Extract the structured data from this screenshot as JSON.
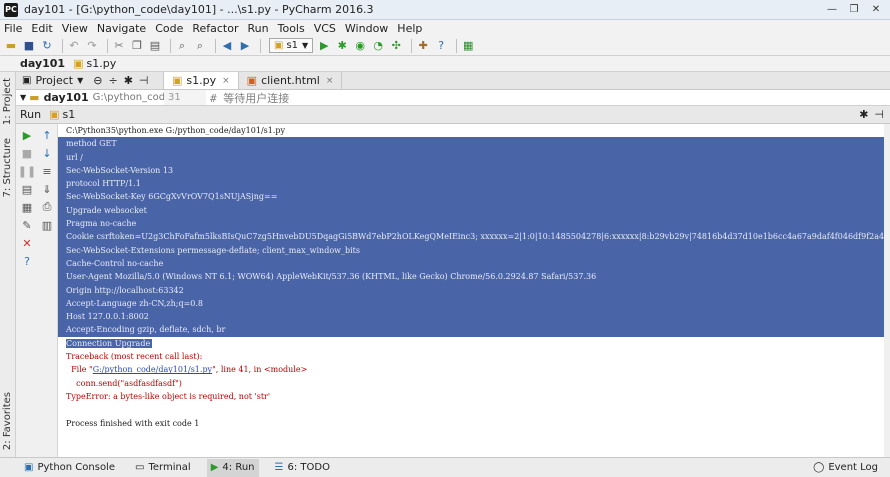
{
  "window": {
    "title": "day101 - [G:\\python_code\\day101] - ...\\s1.py - PyCharm 2016.3",
    "minimize": "—",
    "restore": "❐",
    "close": "✕"
  },
  "menu": [
    "File",
    "Edit",
    "View",
    "Navigate",
    "Code",
    "Refactor",
    "Run",
    "Tools",
    "VCS",
    "Window",
    "Help"
  ],
  "toolbar": {
    "run_config": "s1"
  },
  "navbar": {
    "project": "day101",
    "file": "s1.py"
  },
  "left_strip": {
    "project_tab": "1: Project",
    "structure_tab": "7: Structure",
    "favorites_tab": "2: Favorites"
  },
  "editor_tabs": {
    "project_label": "Project",
    "tabs": [
      {
        "label": "s1.py",
        "close": "×"
      },
      {
        "label": "client.html",
        "close": "×"
      }
    ]
  },
  "project_tree": {
    "root": "day101",
    "root_path": "G:\\python_code\\day",
    "line_number": "31",
    "code_line": "# 等待用户连接"
  },
  "run_panel": {
    "label": "Run",
    "config": "s1"
  },
  "console": {
    "lines": [
      {
        "text": "C:\\Python35\\python.exe G:/python_code/day101/s1.py",
        "style": "plain"
      },
      {
        "text": "method GET",
        "style": "sel"
      },
      {
        "text": "url /",
        "style": "sel"
      },
      {
        "text": "Sec-WebSocket-Version 13",
        "style": "sel"
      },
      {
        "text": "protocol HTTP/1.1",
        "style": "sel"
      },
      {
        "text": "Sec-WebSocket-Key 6GCgXvVrOV7Q1sNUjASjng==",
        "style": "sel"
      },
      {
        "text": "Upgrade websocket",
        "style": "sel"
      },
      {
        "text": "Pragma no-cache",
        "style": "sel"
      },
      {
        "text": "Cookie csrftoken=U2g3ChFoFafm5lksBIsQuC7zg5HnvebDU5DqagGi5BWd7ebP2hOLKegQMeIEinc3; xxxxxx=2|1:0|10:1485504278|6:xxxxxx|8:b29vb29v|74816b4d37d10e1b6cc4a67a9daf4f046df9f2a4ba6faed994c1a4c7c5f9ed38",
        "style": "sel"
      },
      {
        "text": "Sec-WebSocket-Extensions permessage-deflate; client_max_window_bits",
        "style": "sel"
      },
      {
        "text": "Cache-Control no-cache",
        "style": "sel"
      },
      {
        "text": "User-Agent Mozilla/5.0 (Windows NT 6.1; WOW64) AppleWebKit/537.36 (KHTML, like Gecko) Chrome/56.0.2924.87 Safari/537.36",
        "style": "sel"
      },
      {
        "text": "Origin http://localhost:63342",
        "style": "sel"
      },
      {
        "text": "Accept-Language zh-CN,zh;q=0.8",
        "style": "sel"
      },
      {
        "text": "Host 127.0.0.1:8002",
        "style": "sel"
      },
      {
        "text": "Accept-Encoding gzip, deflate, sdch, br",
        "style": "sel"
      },
      {
        "text": "Connection Upgrade",
        "style": "partial"
      },
      {
        "text": "Traceback (most recent call last):",
        "style": "err"
      },
      {
        "text_before": "  File \"",
        "link": "G:/python_code/day101/s1.py",
        "text_after": "\", line 41, in <module>",
        "style": "errlink"
      },
      {
        "text": "    conn.send(\"asdfasdfasdf\")",
        "style": "err"
      },
      {
        "text": "TypeError: a bytes-like object is required, not 'str'",
        "style": "err"
      },
      {
        "text": "",
        "style": "plain"
      },
      {
        "text": "Process finished with exit code 1",
        "style": "plain"
      }
    ]
  },
  "bottom_bar": {
    "python_console": "Python Console",
    "terminal": "Terminal",
    "run": "4: Run",
    "todo": "6: TODO",
    "event_log": "Event Log"
  },
  "colors": {
    "selection": "#4a64a8",
    "error_text": "#c00000",
    "link": "#2846c8"
  }
}
